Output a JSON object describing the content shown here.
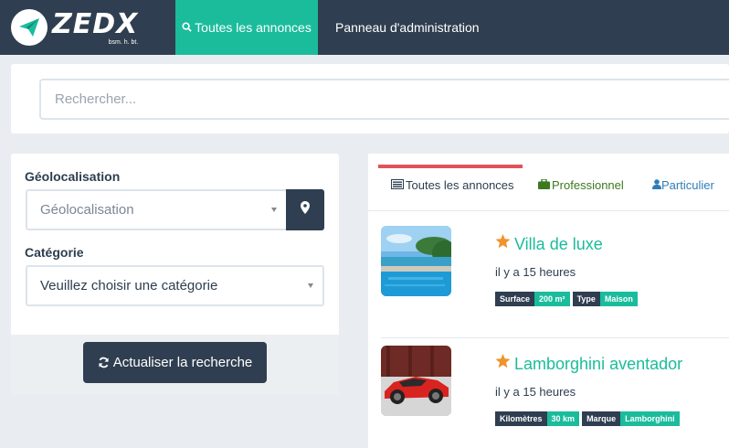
{
  "brand": {
    "name": "ZEDX",
    "tagline": "bsm. h. bt.",
    "logo_icon": "paper-plane-icon"
  },
  "nav": {
    "items": [
      {
        "label": "Toutes les annonces",
        "icon": "search-icon",
        "active": true
      },
      {
        "label": "Panneau d'administration",
        "active": false
      }
    ]
  },
  "search": {
    "placeholder": "Rechercher...",
    "value": ""
  },
  "filters": {
    "geo_label": "Géolocalisation",
    "geo_placeholder": "Géolocalisation",
    "geo_button_icon": "map-marker-icon",
    "category_label": "Catégorie",
    "category_value": "Veuillez choisir une catégorie",
    "refresh_label": "Actualiser la recherche",
    "refresh_icon": "refresh-icon"
  },
  "tabs": [
    {
      "label": "Toutes les annonces",
      "icon": "list-icon",
      "active": true
    },
    {
      "label": "Professionnel",
      "icon": "briefcase-icon",
      "active": false
    },
    {
      "label": "Particulier",
      "icon": "user-icon",
      "active": false
    }
  ],
  "ads": [
    {
      "title": "Villa de luxe",
      "time": "il y a 15 heures",
      "thumb": "villa-pool-photo",
      "tags": [
        {
          "key": "Surface",
          "value": "200 m²"
        },
        {
          "key": "Type",
          "value": "Maison"
        }
      ]
    },
    {
      "title": "Lamborghini aventador",
      "time": "il y a 15 heures",
      "thumb": "red-sports-car-photo",
      "tags": [
        {
          "key": "Kilomètres",
          "value": "30 km"
        },
        {
          "key": "Marque",
          "value": "Lamborghini"
        }
      ]
    }
  ],
  "colors": {
    "navbar": "#2f3e50",
    "accent": "#1abc9c",
    "tab_active_bar": "#e0535a",
    "star": "#f0932b"
  }
}
